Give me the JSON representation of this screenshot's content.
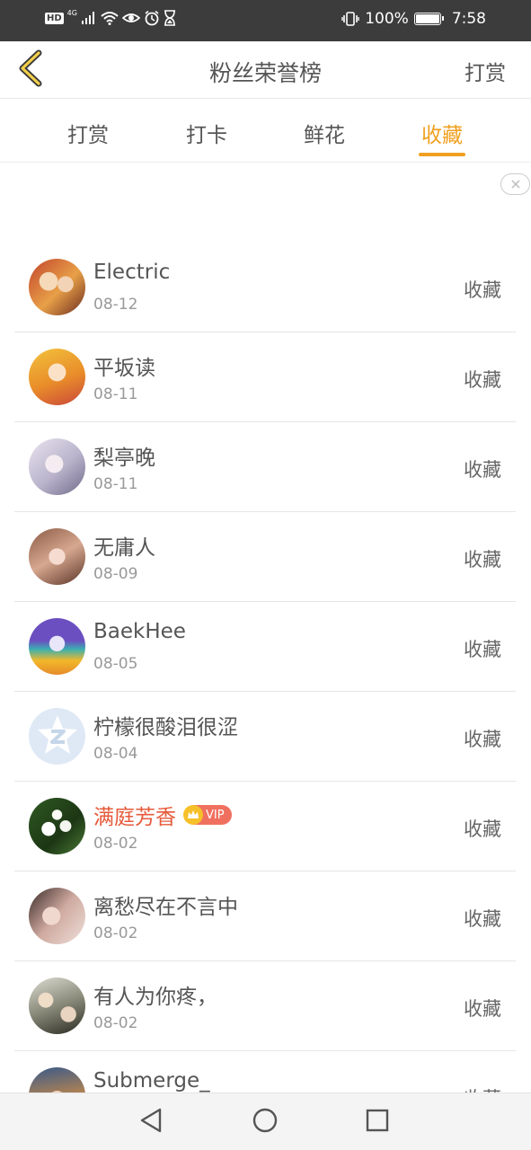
{
  "status_bar": {
    "hd": "HD",
    "network": "4G",
    "battery_text": "100%",
    "battery_level": 1.0,
    "time": "7:58"
  },
  "header": {
    "title": "粉丝荣誉榜",
    "action_label": "打赏",
    "back_icon": "chevron-left-icon"
  },
  "tabs": [
    {
      "label": "打赏",
      "active": false
    },
    {
      "label": "打卡",
      "active": false
    },
    {
      "label": "鲜花",
      "active": false
    },
    {
      "label": "收藏",
      "active": true
    }
  ],
  "accent_color": "#f0a020",
  "highlight_color": "#e65a3a",
  "fans": [
    {
      "name": "Electric",
      "date": "08-12",
      "action": "收藏"
    },
    {
      "name": "平坂读",
      "date": "08-11",
      "action": "收藏"
    },
    {
      "name": "梨亭晚",
      "date": "08-11",
      "action": "收藏"
    },
    {
      "name": "无庸人",
      "date": "08-09",
      "action": "收藏"
    },
    {
      "name": "BaekHee",
      "date": "08-05",
      "action": "收藏"
    },
    {
      "name": "柠檬很酸泪很涩",
      "date": "08-04",
      "action": "收藏"
    },
    {
      "name": "满庭芳香",
      "date": "08-02",
      "action": "收藏",
      "vip": "VIP"
    },
    {
      "name": "离愁尽在不言中",
      "date": "08-02",
      "action": "收藏"
    },
    {
      "name": "有人为你疼，",
      "date": "08-02",
      "action": "收藏"
    },
    {
      "name": "Submerge_",
      "date": "",
      "action": "收藏"
    }
  ],
  "nav": {
    "back": "triangle-back-icon",
    "home": "circle-home-icon",
    "recents": "square-recents-icon"
  }
}
